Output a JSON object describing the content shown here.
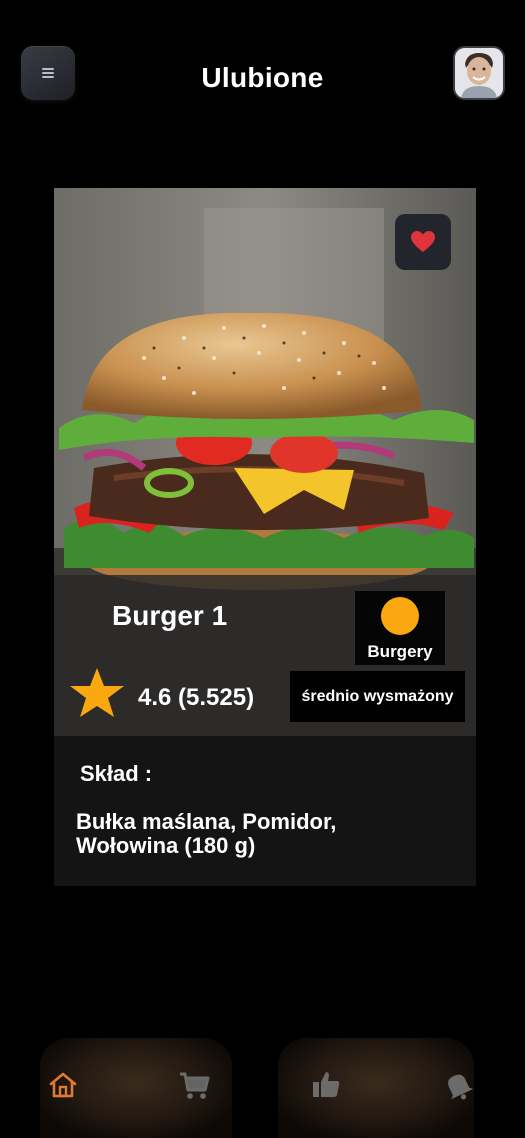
{
  "header": {
    "title": "Ulubione"
  },
  "product": {
    "name": "Burger 1",
    "category": "Burgery",
    "rating": "4.6 (5.525)",
    "doneness": "średnio wysmażony",
    "favorite": true,
    "ingredients_title": "Skład :",
    "ingredients": "Bułka maślana, Pomidor, Wołowina (180 g)"
  },
  "colors": {
    "accent": "#f9a80f",
    "favorite": "#e0343c",
    "nav_active": "#e07a2e",
    "nav_inactive": "#6b6b6b"
  },
  "icons": {
    "menu": "menu-icon",
    "favorite": "heart-icon",
    "rating": "star-icon",
    "nav": [
      "home-icon",
      "cart-icon",
      "thumbs-up-icon",
      "bell-icon"
    ]
  }
}
